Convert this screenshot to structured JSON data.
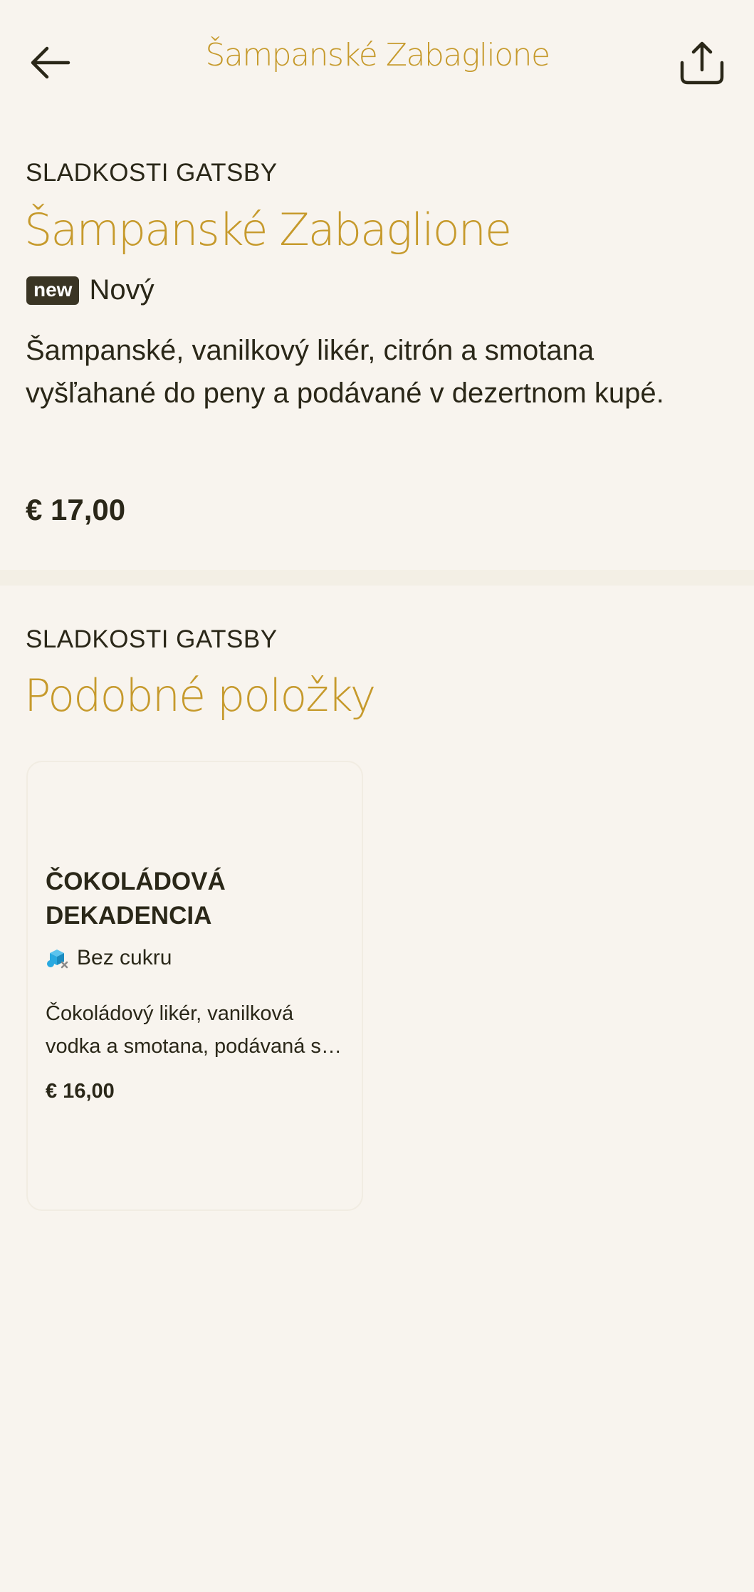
{
  "header": {
    "title": "Šampanské Zabaglione",
    "back_icon": "arrow-left-icon",
    "share_icon": "share-icon"
  },
  "item": {
    "category": "SLADKOSTI GATSBY",
    "name": "Šampanské Zabaglione",
    "badge": "new",
    "badge_label": "Nový",
    "description": "Šampanské, vanilkový likér, citrón a smotana vyšľahané do peny a podávané v dezertnom kupé.",
    "price": "€ 17,00"
  },
  "similar": {
    "category": "SLADKOSTI GATSBY",
    "title": "Podobné položky",
    "items": [
      {
        "name": "ČOKOLÁDOVÁ DEKADENCIA",
        "tag_icon": "sugar-free-icon",
        "tag": "Bez cukru",
        "description": "Čokoládový likér, vanilková vodka a smotana, podávaná s čokoládou",
        "price": "€ 16,00"
      }
    ]
  },
  "colors": {
    "accent": "#c69a2c",
    "background": "#f8f4ee",
    "text": "#2a2718",
    "badge": "#3a3524",
    "icon_blue": "#29a9e0"
  }
}
